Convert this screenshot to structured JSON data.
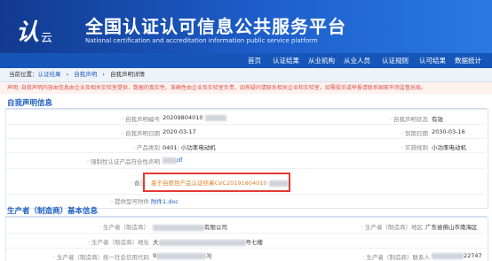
{
  "header": {
    "logo_text": "认",
    "logo_sub": "云",
    "title_cn": "全国认证认可信息公共服务平台",
    "title_en": "National certification and accreditation information public service platform"
  },
  "nav": {
    "items": [
      "首页",
      "认证结果",
      "从业机构",
      "从业人员",
      "认证规则",
      "认可结果",
      "数据统计"
    ]
  },
  "breadcrumb": {
    "prefix": "当前位置：",
    "items": [
      "认证结果",
      "自我声明",
      "自我声明详情"
    ],
    "sep": "›"
  },
  "notice": "声明: 自我声明内容由信息由企业及相关实验室提供，数据的真实性、准确性由企业及实验室负责，如有疑问请联系相关企业和实验室，如需投诉或举报请联系国家市场监督总局。",
  "self_declaration": {
    "section_title": "自我声明信息",
    "declaration_no_label": "· 自我声明编号",
    "declaration_no": "20209804010",
    "status_label": "· 自我声明状态",
    "status": "有效",
    "date_label": "· 自我声明日期",
    "date": "2020-03-17",
    "expiry_label": "· 到期日期",
    "expiry": "2030-03-16",
    "category_label": "· 产品类别",
    "category": "0401: 小功率电动机",
    "rule_label": "· 实施规则",
    "rule": "小功率电动机",
    "report_label": "· 强制性认证产品符合性声明",
    "report_value": "df",
    "remark_label": "· 备注",
    "remark": "基于自愿性产品认证结果CVC20191804010",
    "attachment_label": "· 提供型号附件",
    "attachment": "附件1.doc"
  },
  "manufacturer": {
    "section_title": "生产者（制造商）基本信息",
    "name_label": "· 生产者（制造商）",
    "name_suffix": "有限公司",
    "region_label": "· 生产者（制造商）地区",
    "region": "广东省佛山市南海区",
    "address_label": "· 生产者（制造商）地址",
    "address_prefix": "大",
    "address_suffix": "号七楼",
    "credit_label": "· 生产者（制造商）统一社会信用代码",
    "credit_prefix": "9",
    "credit_suffix": "3J",
    "contact_label": "· 生产者（制造商）联系人",
    "contact_value": "22747"
  },
  "colors": {
    "header_start": "#123a8f",
    "header_end": "#2b79e0",
    "nav_bg": "#1656b8",
    "link": "#1f5fbf",
    "notice_text": "#d9534f",
    "highlight_border": "#e53935",
    "remark_text": "#e67e22"
  }
}
